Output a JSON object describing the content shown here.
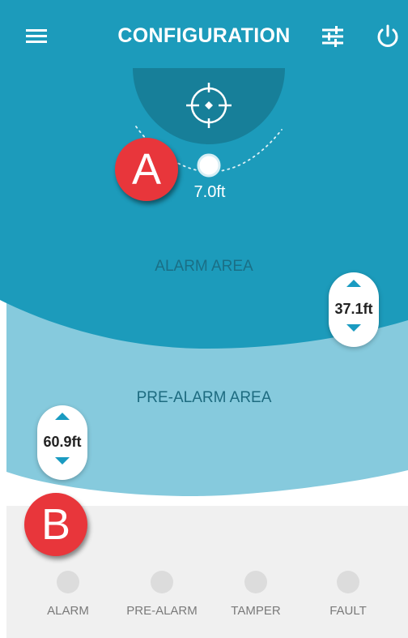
{
  "header": {
    "title": "CONFIGURATION",
    "menu_icon": "menu-icon",
    "settings_icon": "sliders-icon",
    "power_icon": "power-icon"
  },
  "radar": {
    "alarm_area_label": "ALARM AREA",
    "pre_alarm_area_label": "PRE-ALARM AREA",
    "inner_distance": "7.0ft",
    "alarm_distance": "37.1ft",
    "pre_alarm_distance": "60.9ft"
  },
  "status": [
    {
      "label": "ALARM"
    },
    {
      "label": "PRE-ALARM"
    },
    {
      "label": "TAMPER"
    },
    {
      "label": "FAULT"
    }
  ],
  "callouts": {
    "a": "A",
    "b": "B"
  },
  "colors": {
    "alarm_area": "#1c9bbb",
    "pre_alarm_area": "#86cadd",
    "sensor_zone": "#177f99",
    "footer_bg": "#f0f0f0",
    "callout": "#e8363b",
    "stepper_arrow": "#1a9bc1"
  }
}
